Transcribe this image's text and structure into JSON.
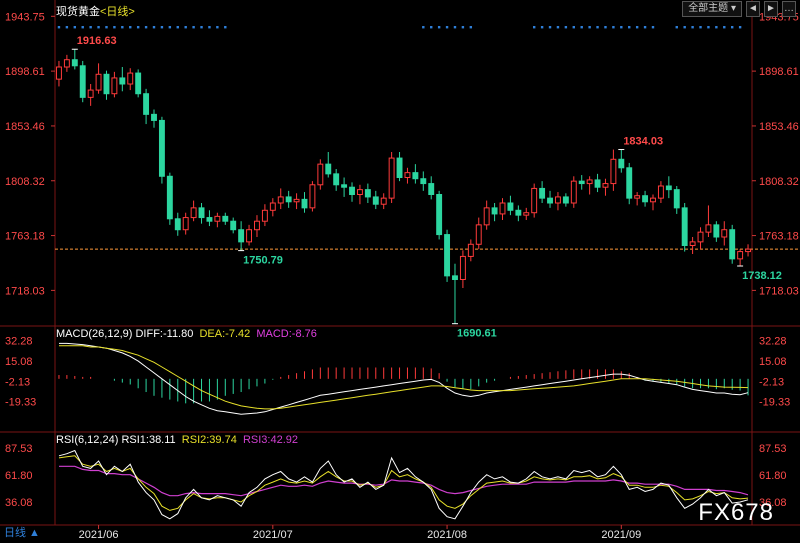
{
  "instrument": {
    "name": "现货黄金",
    "period": "<日线>"
  },
  "toolbar": {
    "dropdown_label": "全部主题",
    "prev_symbol": "◄",
    "next_symbol": "►",
    "dots_symbol": "…"
  },
  "watermark": "FX678",
  "period_badge": "日线 ▲",
  "colors": {
    "up": "#ff3b3b",
    "down": "#2cd6a0",
    "price_axis": "#ff4a4a",
    "dif": "#ffffff",
    "dea": "#e7e02a",
    "macd": "#e040e0",
    "rsi1": "#ffffff",
    "rsi2": "#e7e02a",
    "rsi3": "#d040d0",
    "dot_marker": "#2f7fd8",
    "ref_line": "#ff9a3a"
  },
  "macd": {
    "title": "MACD(26,12,9)",
    "dif_label": "DIFF:-11.80",
    "dea_label": "DEA:-7.42",
    "macd_label": "MACD:-8.76"
  },
  "rsi": {
    "title": "RSI(6,12,24)",
    "rsi1_label": "RSI1:38.11",
    "rsi2_label": "RSI2:39.74",
    "rsi3_label": "RSI3:42.92"
  },
  "chart_data": [
    {
      "type": "candlestick",
      "y_ticks": [
        "1943.75",
        "1898.61",
        "1853.46",
        "1808.32",
        "1763.18",
        "1718.03"
      ],
      "ylim": [
        1692,
        1944
      ],
      "x_ticks": [
        "2021/06",
        "2021/07",
        "2021/08",
        "2021/09"
      ],
      "x_tick_index": [
        5,
        27,
        49,
        71
      ],
      "last_price": 1752,
      "annotations": [
        {
          "label": "1916.63",
          "index": 2,
          "value": 1916.63
        },
        {
          "label": "1750.79",
          "index": 23,
          "value": 1750.79
        },
        {
          "label": "1690.61",
          "index": 50,
          "value": 1690.61
        },
        {
          "label": "1834.03",
          "index": 71,
          "value": 1834.03
        },
        {
          "label": "1738.12",
          "index": 86,
          "value": 1738.12
        }
      ],
      "ohlc": [
        [
          1892,
          1907,
          1886,
          1902
        ],
        [
          1902,
          1912,
          1898,
          1908
        ],
        [
          1908,
          1916.6,
          1900,
          1903
        ],
        [
          1903,
          1907,
          1873,
          1877
        ],
        [
          1877,
          1888,
          1870,
          1883
        ],
        [
          1883,
          1905,
          1880,
          1896
        ],
        [
          1896,
          1899,
          1875,
          1880
        ],
        [
          1880,
          1898,
          1877,
          1893
        ],
        [
          1893,
          1902,
          1882,
          1888
        ],
        [
          1888,
          1901,
          1883,
          1897
        ],
        [
          1897,
          1900,
          1877,
          1880
        ],
        [
          1880,
          1884,
          1855,
          1863
        ],
        [
          1863,
          1867,
          1852,
          1858
        ],
        [
          1858,
          1861,
          1806,
          1812
        ],
        [
          1812,
          1815,
          1772,
          1777
        ],
        [
          1777,
          1782,
          1763,
          1768
        ],
        [
          1768,
          1782,
          1764,
          1778
        ],
        [
          1778,
          1792,
          1775,
          1786
        ],
        [
          1786,
          1790,
          1773,
          1778
        ],
        [
          1778,
          1784,
          1771,
          1775
        ],
        [
          1775,
          1782,
          1770,
          1779
        ],
        [
          1779,
          1782,
          1772,
          1775
        ],
        [
          1775,
          1778,
          1765,
          1768
        ],
        [
          1768,
          1775,
          1750.8,
          1758
        ],
        [
          1758,
          1772,
          1755,
          1768
        ],
        [
          1768,
          1780,
          1762,
          1775
        ],
        [
          1775,
          1789,
          1771,
          1784
        ],
        [
          1784,
          1794,
          1779,
          1790
        ],
        [
          1790,
          1802,
          1785,
          1795
        ],
        [
          1795,
          1800,
          1786,
          1791
        ],
        [
          1791,
          1798,
          1785,
          1793
        ],
        [
          1793,
          1799,
          1782,
          1786
        ],
        [
          1786,
          1808,
          1783,
          1805
        ],
        [
          1805,
          1826,
          1801,
          1822
        ],
        [
          1822,
          1832,
          1811,
          1814
        ],
        [
          1814,
          1818,
          1800,
          1805
        ],
        [
          1805,
          1811,
          1795,
          1803
        ],
        [
          1803,
          1807,
          1791,
          1797
        ],
        [
          1797,
          1805,
          1789,
          1801
        ],
        [
          1801,
          1806,
          1790,
          1795
        ],
        [
          1795,
          1800,
          1785,
          1789
        ],
        [
          1789,
          1798,
          1785,
          1794
        ],
        [
          1794,
          1832,
          1790,
          1827
        ],
        [
          1827,
          1832,
          1808,
          1811
        ],
        [
          1811,
          1819,
          1806,
          1815
        ],
        [
          1815,
          1822,
          1806,
          1810
        ],
        [
          1810,
          1816,
          1800,
          1806
        ],
        [
          1806,
          1812,
          1793,
          1797
        ],
        [
          1797,
          1800,
          1760,
          1764
        ],
        [
          1764,
          1768,
          1725,
          1730
        ],
        [
          1730,
          1740,
          1690.6,
          1727
        ],
        [
          1727,
          1751,
          1720,
          1746
        ],
        [
          1746,
          1760,
          1742,
          1756
        ],
        [
          1756,
          1778,
          1752,
          1772
        ],
        [
          1772,
          1792,
          1768,
          1786
        ],
        [
          1786,
          1790,
          1775,
          1781
        ],
        [
          1781,
          1794,
          1776,
          1790
        ],
        [
          1790,
          1796,
          1780,
          1784
        ],
        [
          1784,
          1788,
          1775,
          1780
        ],
        [
          1780,
          1786,
          1776,
          1782
        ],
        [
          1782,
          1806,
          1778,
          1802
        ],
        [
          1802,
          1808,
          1790,
          1794
        ],
        [
          1794,
          1800,
          1786,
          1790
        ],
        [
          1790,
          1799,
          1784,
          1795
        ],
        [
          1795,
          1798,
          1787,
          1790
        ],
        [
          1790,
          1812,
          1786,
          1808
        ],
        [
          1808,
          1813,
          1801,
          1806
        ],
        [
          1806,
          1812,
          1797,
          1809
        ],
        [
          1809,
          1814,
          1799,
          1803
        ],
        [
          1803,
          1810,
          1796,
          1806
        ],
        [
          1806,
          1834,
          1800,
          1826
        ],
        [
          1826,
          1834,
          1815,
          1819
        ],
        [
          1819,
          1823,
          1789,
          1794
        ],
        [
          1794,
          1799,
          1788,
          1796
        ],
        [
          1796,
          1800,
          1787,
          1791
        ],
        [
          1791,
          1797,
          1784,
          1794
        ],
        [
          1794,
          1808,
          1790,
          1804
        ],
        [
          1804,
          1812,
          1794,
          1801
        ],
        [
          1801,
          1804,
          1781,
          1786
        ],
        [
          1786,
          1790,
          1750,
          1755
        ],
        [
          1755,
          1762,
          1748,
          1758
        ],
        [
          1758,
          1770,
          1752,
          1766
        ],
        [
          1766,
          1788,
          1762,
          1772
        ],
        [
          1772,
          1775,
          1758,
          1762
        ],
        [
          1762,
          1775,
          1755,
          1768
        ],
        [
          1768,
          1772,
          1740,
          1744
        ],
        [
          1744,
          1752,
          1738.1,
          1750
        ],
        [
          1750,
          1756,
          1746,
          1752
        ]
      ]
    },
    {
      "type": "line",
      "name": "MACD(26,12,9)",
      "y_ticks": [
        "32.28",
        "15.08",
        "-2.13",
        "-19.33"
      ],
      "ylim": [
        -40,
        38
      ],
      "series": [
        {
          "name": "DIFF",
          "values": [
            30,
            30,
            29.5,
            29,
            28,
            27,
            26,
            24,
            22,
            19,
            15,
            10,
            5,
            0,
            -5,
            -10,
            -15,
            -19,
            -22,
            -25,
            -27,
            -28,
            -29,
            -30,
            -29.5,
            -29,
            -28,
            -26,
            -24,
            -22,
            -20,
            -18,
            -16,
            -14,
            -13,
            -12,
            -11,
            -10,
            -9,
            -8,
            -7,
            -6,
            -5,
            -4,
            -3,
            -2,
            -1,
            -0.5,
            -3,
            -8,
            -12,
            -14,
            -15,
            -14,
            -12,
            -11,
            -10,
            -9,
            -8,
            -7,
            -6,
            -5,
            -4,
            -3,
            -2,
            -1,
            0,
            1,
            2,
            3,
            4,
            4,
            3,
            1,
            -1,
            -2,
            -3,
            -4,
            -5,
            -7,
            -9,
            -10,
            -11,
            -12,
            -12,
            -13,
            -13.5,
            -11.8
          ]
        },
        {
          "name": "DEA",
          "values": [
            28,
            28,
            28,
            28,
            27,
            27,
            26,
            25,
            24,
            22,
            20,
            17,
            14,
            10,
            6,
            2,
            -2,
            -6,
            -10,
            -13,
            -16,
            -19,
            -21,
            -23,
            -24,
            -25,
            -25.5,
            -25.5,
            -25,
            -24,
            -23,
            -22,
            -21,
            -20,
            -19,
            -18,
            -17,
            -16,
            -15,
            -14,
            -13,
            -12,
            -11,
            -10,
            -9,
            -8,
            -7,
            -6,
            -6,
            -6.5,
            -7.5,
            -8.5,
            -9.5,
            -10,
            -10,
            -10,
            -10,
            -10,
            -9.5,
            -9,
            -8.5,
            -8,
            -7.5,
            -7,
            -6.5,
            -6,
            -5,
            -4,
            -3,
            -2,
            -1,
            0,
            0,
            0,
            0,
            -0.5,
            -1,
            -1.5,
            -2,
            -3,
            -4,
            -5,
            -6,
            -6.5,
            -7,
            -7.2,
            -7.3,
            -7.42
          ]
        },
        {
          "name": "MACD",
          "values": [
            2,
            2,
            1.5,
            1,
            1,
            0,
            0,
            -1,
            -2,
            -3,
            -5,
            -7,
            -9,
            -10,
            -11,
            -12,
            -13,
            -13,
            -12,
            -12,
            -11,
            -9,
            -8,
            -7,
            -5.5,
            -4,
            -2.5,
            -0.5,
            1,
            2,
            3,
            4,
            5,
            6,
            6,
            6,
            6,
            6,
            6,
            6,
            6,
            6,
            6,
            6,
            6,
            6,
            6,
            5.5,
            3,
            -1.5,
            -4.5,
            -5.5,
            -5.5,
            -4,
            -2,
            -1,
            0,
            1,
            1.5,
            2,
            2.5,
            3,
            3.5,
            4,
            4.5,
            5,
            5,
            5,
            5,
            5,
            5,
            4,
            3,
            1,
            -1,
            -1.5,
            -2,
            -2.5,
            -3,
            -4,
            -5,
            -5,
            -5,
            -5.5,
            -5,
            -5.8,
            -6.2,
            -8.76
          ]
        }
      ]
    },
    {
      "type": "line",
      "name": "RSI(6,12,24)",
      "y_ticks": [
        "87.53",
        "61.80",
        "36.08"
      ],
      "ylim": [
        17,
        95
      ],
      "series": [
        {
          "name": "RSI1",
          "values": [
            80,
            82,
            85,
            70,
            68,
            75,
            62,
            70,
            65,
            72,
            55,
            45,
            38,
            24,
            20,
            25,
            40,
            48,
            40,
            38,
            42,
            40,
            38,
            32,
            45,
            50,
            58,
            62,
            65,
            58,
            55,
            60,
            55,
            68,
            75,
            62,
            55,
            58,
            50,
            55,
            48,
            52,
            78,
            64,
            68,
            60,
            55,
            48,
            30,
            22,
            20,
            32,
            45,
            55,
            62,
            58,
            60,
            55,
            54,
            58,
            65,
            60,
            58,
            60,
            58,
            66,
            64,
            66,
            60,
            62,
            70,
            62,
            48,
            50,
            46,
            48,
            54,
            52,
            40,
            30,
            34,
            40,
            48,
            42,
            45,
            35,
            36,
            38.11
          ]
        },
        {
          "name": "RSI2",
          "values": [
            78,
            79,
            80,
            72,
            70,
            72,
            65,
            68,
            65,
            68,
            58,
            50,
            44,
            32,
            28,
            30,
            38,
            44,
            40,
            39,
            40,
            40,
            38,
            36,
            42,
            46,
            52,
            55,
            58,
            55,
            54,
            56,
            54,
            60,
            65,
            60,
            56,
            56,
            52,
            54,
            50,
            52,
            66,
            60,
            62,
            58,
            55,
            50,
            38,
            32,
            30,
            34,
            42,
            48,
            54,
            55,
            56,
            54,
            54,
            56,
            60,
            58,
            57,
            58,
            57,
            60,
            60,
            61,
            58,
            59,
            63,
            60,
            52,
            52,
            50,
            50,
            52,
            51,
            45,
            38,
            39,
            42,
            46,
            44,
            45,
            40,
            39,
            39.74
          ]
        },
        {
          "name": "RSI3",
          "values": [
            70,
            70,
            70,
            67,
            66,
            66,
            63,
            63,
            62,
            62,
            58,
            54,
            50,
            45,
            42,
            42,
            44,
            45,
            44,
            44,
            44,
            44,
            43,
            42,
            44,
            46,
            48,
            50,
            52,
            51,
            51,
            52,
            51,
            54,
            56,
            55,
            54,
            54,
            53,
            53,
            52,
            53,
            57,
            56,
            56,
            55,
            54,
            52,
            48,
            45,
            44,
            45,
            47,
            49,
            51,
            52,
            53,
            53,
            53,
            53,
            55,
            55,
            55,
            55,
            55,
            56,
            56,
            56,
            56,
            56,
            57,
            56,
            54,
            54,
            53,
            53,
            53,
            53,
            51,
            48,
            48,
            48,
            48,
            47,
            47,
            46,
            45,
            42.92
          ]
        }
      ]
    }
  ]
}
